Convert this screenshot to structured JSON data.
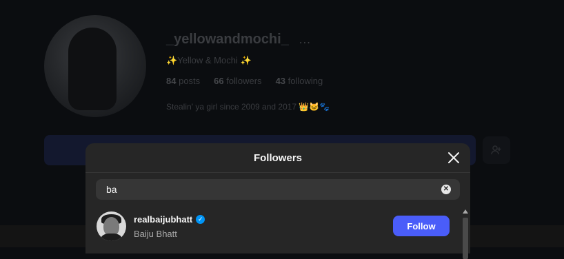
{
  "profile": {
    "username": "_yellowandmochi_",
    "more_icon": "…",
    "display_name": "✨Yellow & Mochi ✨",
    "stats": {
      "posts_count": "84",
      "posts_label": "posts",
      "followers_count": "66",
      "followers_label": "followers",
      "following_count": "43",
      "following_label": "following"
    },
    "bio": "Stealin' ya girl since 2009 and 2017 👑🐱🐾"
  },
  "modal": {
    "title": "Followers",
    "close_icon": "close-icon",
    "search": {
      "value": "ba",
      "clear_icon": "✕"
    },
    "followers": [
      {
        "username": "realbaijubhatt",
        "verified": true,
        "verified_mark": "✓",
        "full_name": "Baiju Bhatt",
        "action_label": "Follow"
      }
    ]
  },
  "colors": {
    "accent": "#4a5df9",
    "verified": "#0095f6",
    "modal_bg": "#262626",
    "overlay_bg": "#0b0d10"
  }
}
